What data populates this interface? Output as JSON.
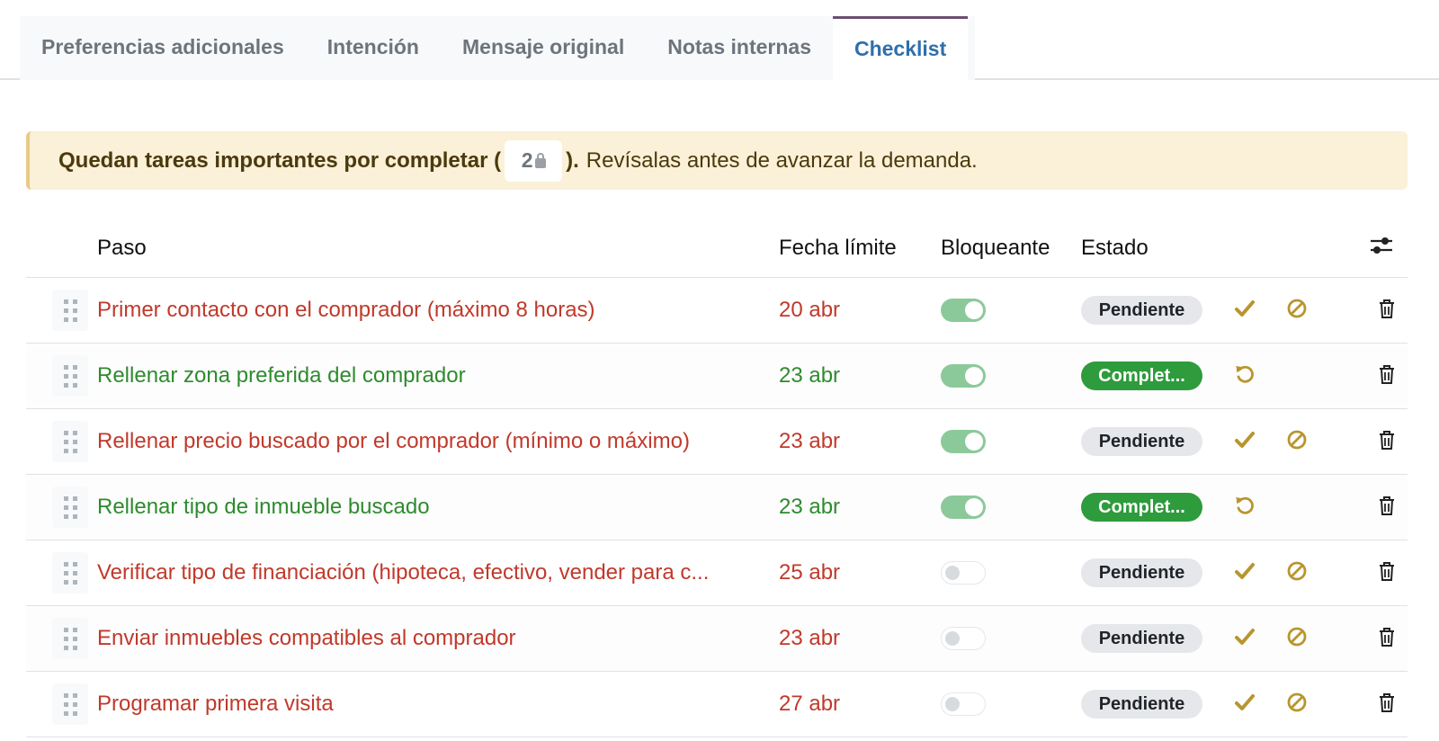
{
  "tabs": [
    {
      "label": "Preferencias adicionales",
      "active": false
    },
    {
      "label": "Intención",
      "active": false
    },
    {
      "label": "Mensaje original",
      "active": false
    },
    {
      "label": "Notas internas",
      "active": false
    },
    {
      "label": "Checklist",
      "active": true
    }
  ],
  "alert": {
    "bold_text": "Quedan tareas importantes por completar (",
    "count": "2",
    "close_paren": ").",
    "rest_text": "Revísalas antes de avanzar la demanda."
  },
  "table": {
    "headers": {
      "step": "Paso",
      "due": "Fecha límite",
      "blocking": "Bloqueante",
      "status": "Estado"
    },
    "rows": [
      {
        "step": "Primer contacto con el comprador (máximo 8 horas)",
        "due": "20 abr",
        "blocking": true,
        "status": "Pendiente",
        "done": false
      },
      {
        "step": "Rellenar zona preferida del comprador",
        "due": "23 abr",
        "blocking": true,
        "status": "Complet...",
        "done": true
      },
      {
        "step": "Rellenar precio buscado por el comprador (mínimo o máximo)",
        "due": "23 abr",
        "blocking": true,
        "status": "Pendiente",
        "done": false
      },
      {
        "step": "Rellenar tipo de inmueble buscado",
        "due": "23 abr",
        "blocking": true,
        "status": "Complet...",
        "done": true
      },
      {
        "step": "Verificar tipo de financiación (hipoteca, efectivo, vender para c...",
        "due": "25 abr",
        "blocking": false,
        "status": "Pendiente",
        "done": false
      },
      {
        "step": "Enviar inmuebles compatibles al comprador",
        "due": "23 abr",
        "blocking": false,
        "status": "Pendiente",
        "done": false
      },
      {
        "step": "Programar primera visita",
        "due": "27 abr",
        "blocking": false,
        "status": "Pendiente",
        "done": false
      }
    ]
  },
  "colors": {
    "pending_text": "#c0392b",
    "done_text": "#2e8b2e",
    "action_gold": "#b8962e",
    "active_tab": "#2f6fab"
  },
  "icons": {
    "settings": "sliders-icon",
    "complete": "check-icon",
    "cancel": "ban-icon",
    "reopen": "undo-icon",
    "delete": "trash-icon",
    "drag": "drag-handle-icon",
    "lock": "lock-icon"
  }
}
